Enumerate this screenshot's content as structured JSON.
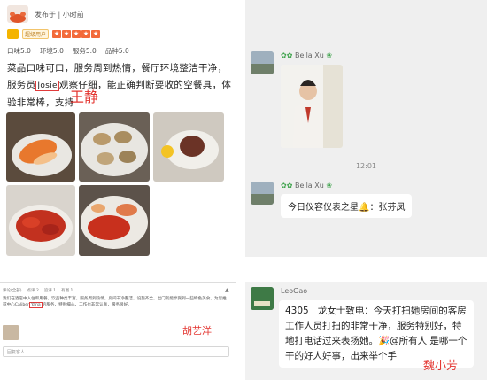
{
  "review": {
    "username": "发布于 | 小时前",
    "badge_label": "超级用户",
    "stars": [
      "★",
      "★",
      "★",
      "★",
      "★"
    ],
    "scores": [
      "口味5.0",
      "环境5.0",
      "服务5.0",
      "品种5.0"
    ],
    "text_before": "菜品口味可口，服务周到热情，餐厅环境整洁干净，服务员",
    "highlight_name": "Josie",
    "text_after": "观察仔细，能正确判断要收的空餐具，体验非常棒，支持",
    "annotation": "王静"
  },
  "ticket": {
    "tabs": [
      "评论(全部)",
      "点评 2",
      "追评 1",
      "有图 1"
    ],
    "sort_icon": "sort-icon",
    "body_before": "我们在酒店中入住和用餐，饮品种类丰富，服务周到热情，房间干净整洁，设施齐全，出门就能享受到一些特色美食，为您推荐中心Caliber",
    "highlight_name": "Yana",
    "body_after": "的服务，特别细心，工作也非常认真，服务很好。",
    "input_placeholder": "回复客人",
    "annotation": "胡艺洋"
  },
  "chat1": {
    "sender1": "Bella  Xu",
    "time": "12:01",
    "sender2": "Bella  Xu",
    "bubble_text": "今日仪容仪表之星",
    "bubble_name": "：张芬凤",
    "icon_leaf": "leaf-icon",
    "icon_bell": "bell-icon"
  },
  "chat2": {
    "sender": "LeoGao",
    "room": "4305",
    "message": "龙女士致电：今天打扫她房间的客房工作人员打扫的非常干净，服务特别好，特地打电话过来表扬她。🎉@所有人 是哪一个干的好人好事，出来举个手",
    "annotation": "魏小芳"
  }
}
